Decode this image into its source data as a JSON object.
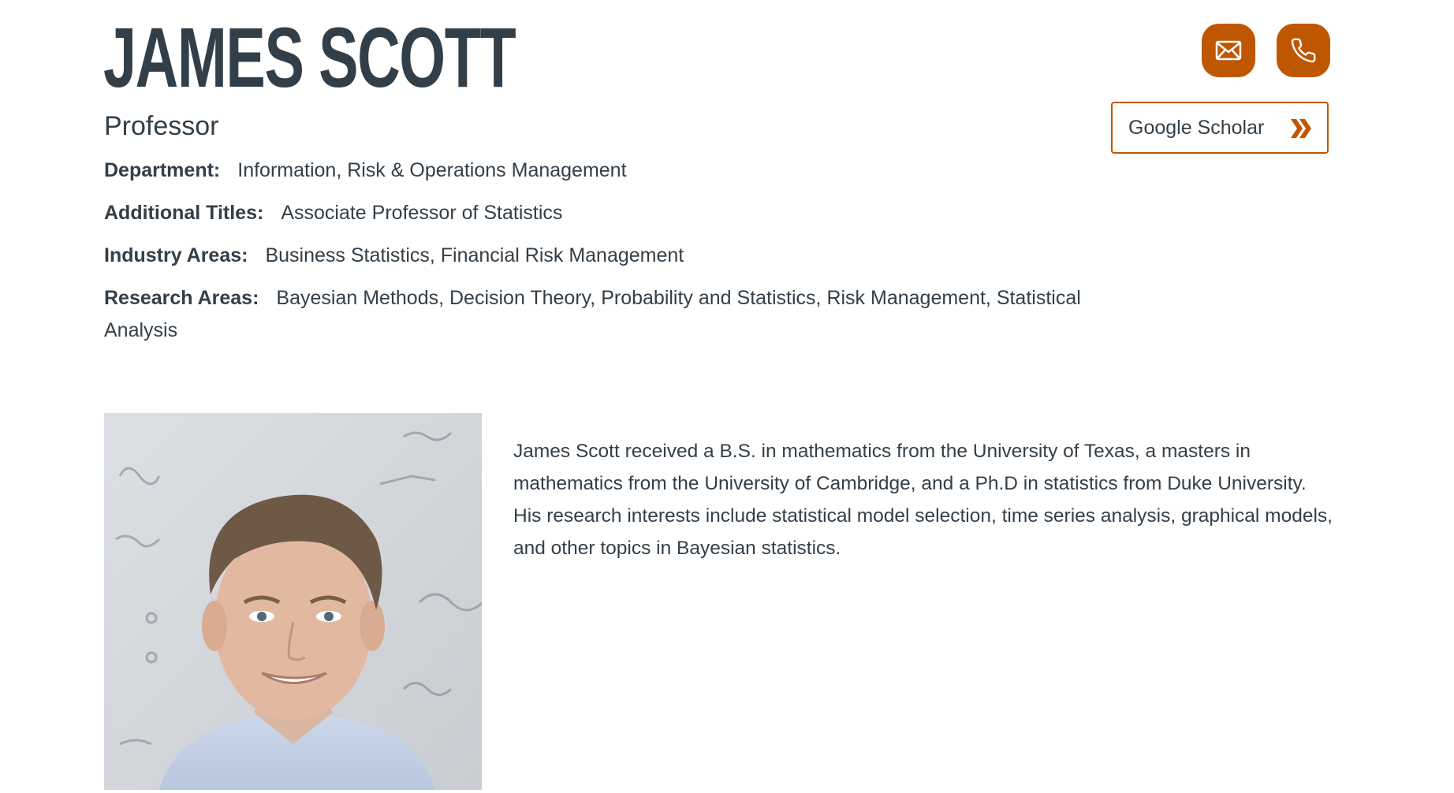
{
  "profile": {
    "name": "JAMES SCOTT",
    "title": "Professor"
  },
  "meta": {
    "department_label": "Department:",
    "department_value": "Information, Risk & Operations Management",
    "additional_titles_label": "Additional Titles:",
    "additional_titles_value": "Associate Professor of Statistics",
    "industry_label": "Industry Areas:",
    "industry_value": "Business Statistics, Financial Risk Management",
    "research_label": "Research Areas:",
    "research_value": "Bayesian Methods, Decision Theory, Probability and Statistics, Risk Management, Statistical Analysis"
  },
  "actions": {
    "email_icon": "envelope-icon",
    "phone_icon": "phone-icon",
    "scholar_label": "Google Scholar",
    "scholar_icon": "double-chevron-right-icon"
  },
  "bio": {
    "text": "James Scott received a B.S. in mathematics from the University of Texas, a masters in mathematics from the University of Cambridge, and a Ph.D in statistics from Duke University. His research interests include statistical model selection, time series analysis, graphical models, and other topics in Bayesian statistics."
  },
  "colors": {
    "accent": "#bf5700",
    "text": "#333f48",
    "background": "#ffffff"
  }
}
